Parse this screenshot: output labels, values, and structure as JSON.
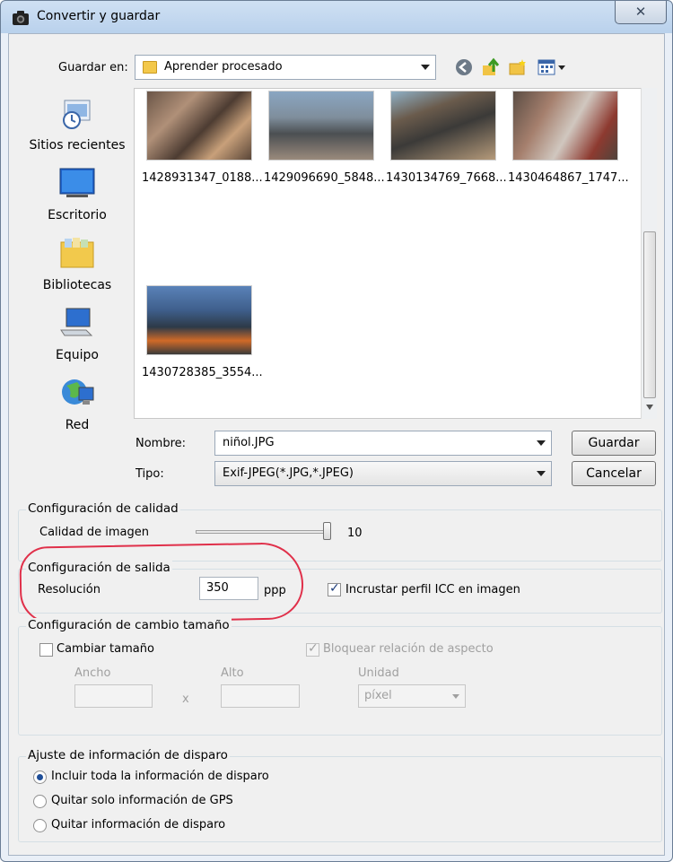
{
  "window": {
    "title": "Convertir y guardar",
    "close_glyph": "✕"
  },
  "location": {
    "label": "Guardar en:",
    "value": "Aprender procesado"
  },
  "places": [
    {
      "label": "Sitios recientes",
      "icon": "recent-places-icon"
    },
    {
      "label": "Escritorio",
      "icon": "desktop-icon"
    },
    {
      "label": "Bibliotecas",
      "icon": "libraries-icon"
    },
    {
      "label": "Equipo",
      "icon": "computer-icon"
    },
    {
      "label": "Red",
      "icon": "network-icon"
    }
  ],
  "files": [
    {
      "name": "1428931347_0188..."
    },
    {
      "name": "1429096690_5848..."
    },
    {
      "name": "1430134769_7668..."
    },
    {
      "name": "1430464867_1747..."
    },
    {
      "name": "1430728385_3554..."
    }
  ],
  "filename": {
    "label": "Nombre:",
    "value": "niñol.JPG"
  },
  "filetype": {
    "label": "Tipo:",
    "value": "Exif-JPEG(*.JPG,*.JPEG)"
  },
  "buttons": {
    "save": "Guardar",
    "cancel": "Cancelar"
  },
  "quality": {
    "group_title": "Configuración de calidad",
    "label": "Calidad de imagen",
    "value": "10"
  },
  "output": {
    "group_title": "Configuración de salida",
    "resolution_label": "Resolución",
    "resolution_value": "350",
    "unit": "ppp",
    "embed_icc_label": "Incrustar perfil ICC en imagen"
  },
  "resize": {
    "group_title": "Configuración de cambio tamaño",
    "resize_label": "Cambiar tamaño",
    "keep_aspect_label": "Bloquear relación de aspecto",
    "width_label": "Ancho",
    "height_label": "Alto",
    "unit_label": "Unidad",
    "unit_value": "píxel",
    "times": "x"
  },
  "shot_info": {
    "group_title": "Ajuste de información de disparo",
    "options": [
      "Incluir toda la información de disparo",
      "Quitar solo información de GPS",
      "Quitar información de disparo"
    ]
  },
  "colors": {
    "annotation": "#e0304a",
    "accent": "#1f4e98"
  }
}
